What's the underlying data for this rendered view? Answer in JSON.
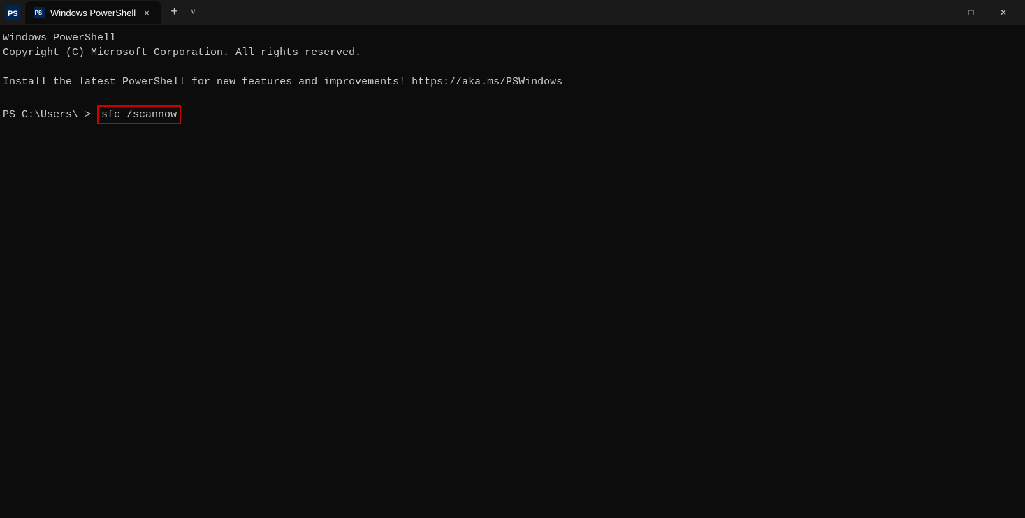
{
  "titlebar": {
    "icon_label": "powershell-icon",
    "tab_title": "Windows PowerShell",
    "close_label": "✕",
    "add_label": "+",
    "dropdown_label": "˅",
    "minimize_label": "─",
    "maximize_label": "□",
    "winclose_label": "✕"
  },
  "terminal": {
    "line1": "Windows PowerShell",
    "line2": "Copyright (C) Microsoft Corporation. All rights reserved.",
    "line3": "",
    "line4": "Install the latest PowerShell for new features and improvements! https://aka.ms/PSWindows",
    "line5": "",
    "prompt_text": "PS C:\\Users\\",
    "prompt_arrow": "> ",
    "command": "sfc /scannow"
  }
}
